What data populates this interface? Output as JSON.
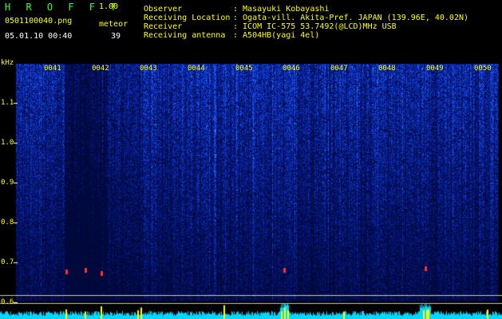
{
  "header": {
    "brand": "H R O F F T",
    "version": "1.00",
    "filename": "0501100040.png",
    "meteor_label": "meteor",
    "datetime": "05.01.10 00:40",
    "meteor_count": "39"
  },
  "info": [
    {
      "key": "Observer",
      "value": ": Masayuki Kobayashi"
    },
    {
      "key": "Receiving Location",
      "value": ": Ogata-vill. Akita-Pref. JAPAN (139.96E, 40.02N)"
    },
    {
      "key": "Receiver",
      "value": ": ICOM IC-575 53.7492(@LCD)MHz USB"
    },
    {
      "key": "Receiving antenna",
      "value": ": A504HB(yagi 4el)"
    }
  ],
  "axis": {
    "unit": "kHz",
    "y_ticks": [
      "1.1",
      "1.0",
      "0.9",
      "0.8",
      "0.7",
      "0.6"
    ],
    "time_ticks": [
      "0041",
      "0042",
      "0043",
      "0044",
      "0045",
      "0046",
      "0047",
      "0048",
      "0049",
      "0050"
    ]
  },
  "colors": {
    "header_yellow": "#ffff00",
    "header_green": "#33ff33",
    "spectrum_dark": "#000a3a",
    "spectrum_bright": "#1a6bff",
    "level_cyan": "#00e5ff",
    "level_yellow": "#ffff00"
  }
}
